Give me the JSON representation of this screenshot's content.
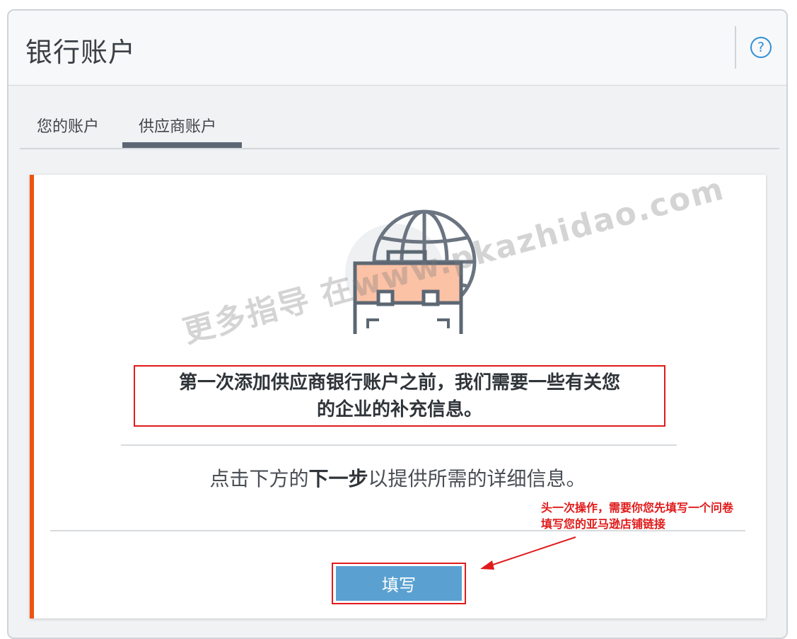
{
  "header": {
    "title": "银行账户",
    "help_icon": "help-circle-icon"
  },
  "tabs": [
    {
      "label": "您的账户",
      "active": false
    },
    {
      "label": "供应商账户",
      "active": true
    }
  ],
  "card": {
    "headline_line1": "第一次添加供应商银行账户之前，我们需要一些有关您",
    "headline_line2": "的企业的补充信息。",
    "instruction_prefix": "点击下方的",
    "instruction_bold": "下一步",
    "instruction_suffix": "以提供所需的详细信息。",
    "button_label": "填写",
    "illustration_icons": [
      "briefcase-icon",
      "globe-icon"
    ]
  },
  "annotation": {
    "line1": "头一次操作，需要你您先填写一个问卷",
    "line2": "填写您的亚马逊店铺链接"
  },
  "watermark": "更多指导 在www.pkazhidao.com",
  "colors": {
    "accent": "#f0520f",
    "button": "#5aa1d2",
    "highlight": "#e01b1b",
    "help_icon": "#2e8fd6",
    "active_tab": "#5c6773"
  }
}
